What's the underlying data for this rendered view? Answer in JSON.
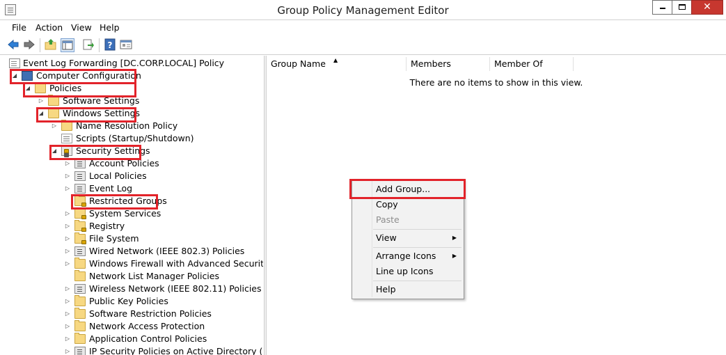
{
  "window": {
    "title": "Group Policy Management Editor"
  },
  "menu": [
    "File",
    "Action",
    "View",
    "Help"
  ],
  "toolbar": [
    "back-icon",
    "forward-icon",
    "up-folder-icon",
    "show-hide-tree-icon",
    "export-list-icon",
    "help-icon",
    "properties-icon"
  ],
  "tree": {
    "root": "Event Log Forwarding [DC.CORP.LOCAL] Policy",
    "computer_configuration": "Computer Configuration",
    "policies": "Policies",
    "software_settings": "Software Settings",
    "windows_settings": "Windows Settings",
    "name_resolution_policy": "Name Resolution Policy",
    "scripts": "Scripts (Startup/Shutdown)",
    "security_settings": "Security Settings",
    "account_policies": "Account Policies",
    "local_policies": "Local Policies",
    "event_log": "Event Log",
    "restricted_groups": "Restricted Groups",
    "system_services": "System Services",
    "registry": "Registry",
    "file_system": "File System",
    "wired_network": "Wired Network (IEEE 802.3) Policies",
    "windows_firewall": "Windows Firewall with Advanced Security",
    "network_list_manager": "Network List Manager Policies",
    "wireless_network": "Wireless Network (IEEE 802.11) Policies",
    "public_key": "Public Key Policies",
    "software_restriction": "Software Restriction Policies",
    "network_access_protection": "Network Access Protection",
    "application_control": "Application Control Policies",
    "ip_security": "IP Security Policies on Active Directory (CORP.L"
  },
  "list": {
    "columns": [
      "Group Name",
      "Members",
      "Member Of"
    ],
    "empty_message": "There are no items to show in this view."
  },
  "context_menu": {
    "add_group": "Add Group...",
    "copy": "Copy",
    "paste": "Paste",
    "view": "View",
    "arrange_icons": "Arrange Icons",
    "line_up_icons": "Line up Icons",
    "help": "Help"
  },
  "colors": {
    "highlight": "#e2232a"
  }
}
